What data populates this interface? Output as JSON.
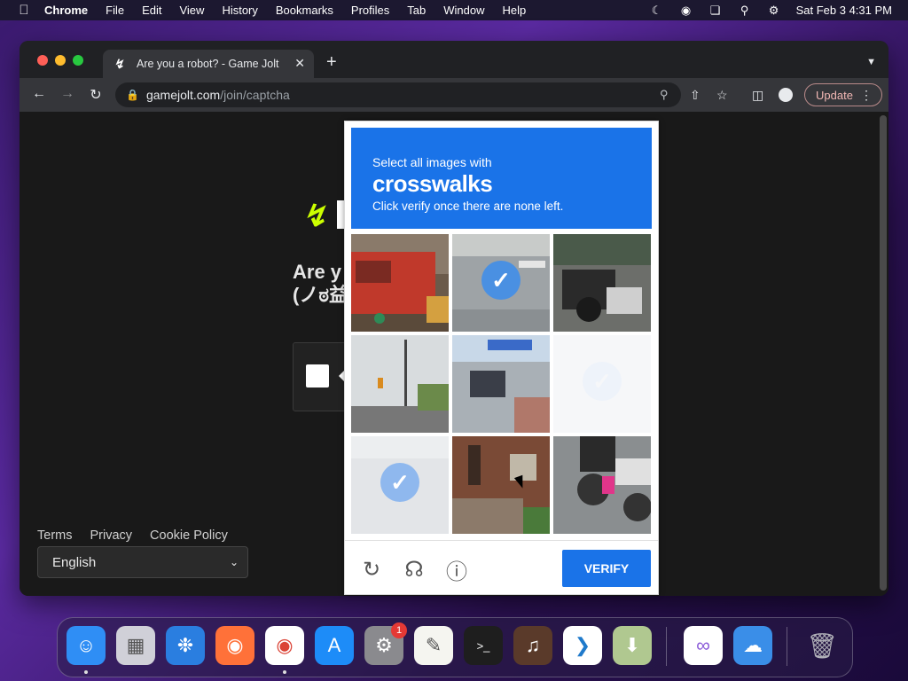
{
  "menubar": {
    "app": "Chrome",
    "items": [
      "File",
      "Edit",
      "View",
      "History",
      "Bookmarks",
      "Profiles",
      "Tab",
      "Window",
      "Help"
    ],
    "clock": "Sat Feb 3  4:31 PM"
  },
  "browser": {
    "tab_title": "Are you a robot? - Game Jolt",
    "url_host": "gamejolt.com",
    "url_path": "/join/captcha",
    "update_label": "Update"
  },
  "page": {
    "heading_line1": "Are y",
    "heading_line2": "(ノಠ益",
    "footer_links": [
      "Terms",
      "Privacy",
      "Cookie Policy"
    ],
    "language": "English"
  },
  "captcha": {
    "prompt_line1": "Select all images with",
    "target": "crosswalks",
    "prompt_line3": "Click verify once there are none left.",
    "verify_label": "VERIFY",
    "tiles": [
      {
        "name": "tile-red-truck",
        "selected": false
      },
      {
        "name": "tile-road-crosswalk",
        "selected": true
      },
      {
        "name": "tile-motorcycles",
        "selected": false
      },
      {
        "name": "tile-traffic-light",
        "selected": false
      },
      {
        "name": "tile-police-truck",
        "selected": false
      },
      {
        "name": "tile-fading-blank",
        "selected": true
      },
      {
        "name": "tile-fading-road",
        "selected": true
      },
      {
        "name": "tile-brick-house",
        "selected": false
      },
      {
        "name": "tile-motorbike-rider",
        "selected": false
      }
    ]
  },
  "dock": {
    "apps": [
      "Finder",
      "Launchpad",
      "Safari",
      "Firefox",
      "Chrome",
      "App Store",
      "System Settings",
      "TextEdit",
      "Terminal",
      "GarageBand",
      "VS Code",
      "Installer",
      "Visual Studio",
      "Weather",
      "Trash"
    ],
    "system_settings_badge": "1"
  }
}
